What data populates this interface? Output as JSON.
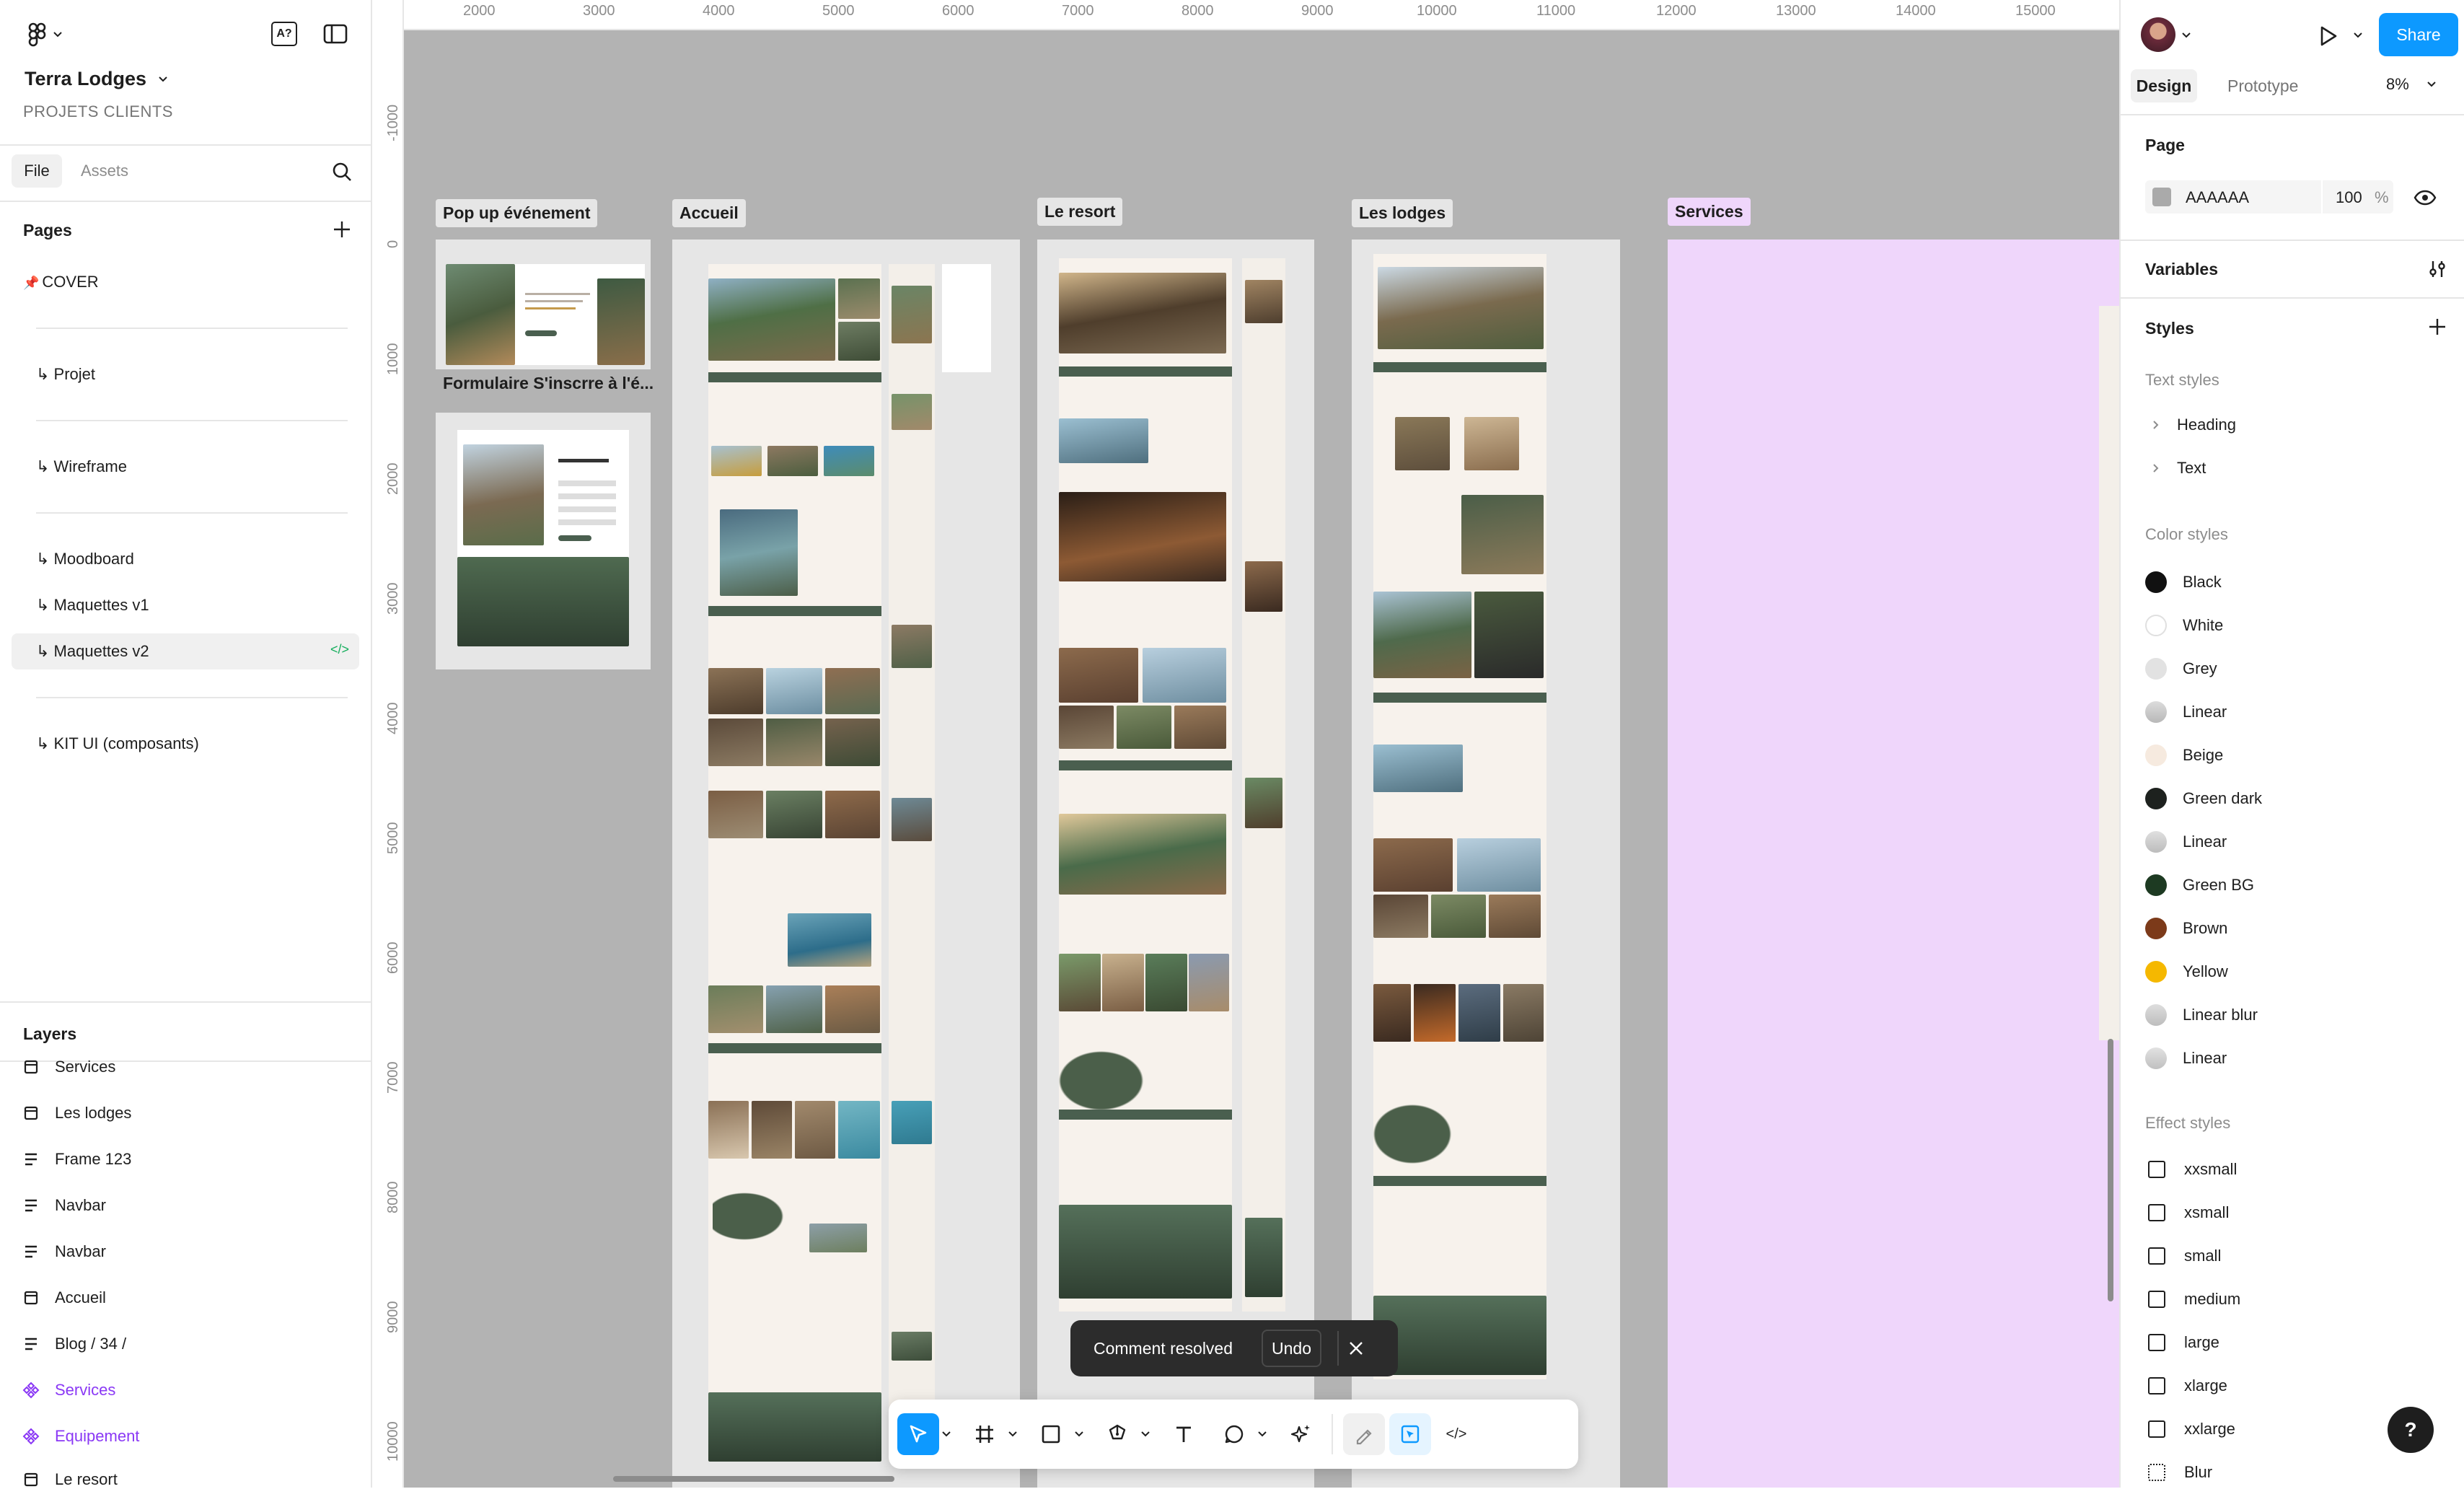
{
  "file": {
    "title": "Terra Lodges",
    "project": "PROJETS CLIENTS"
  },
  "left_tabs": {
    "file": "File",
    "assets": "Assets"
  },
  "pages": {
    "heading": "Pages",
    "items": [
      {
        "label": "COVER",
        "pin": "📌"
      },
      {
        "label": "↳ Projet"
      },
      {
        "label": "↳ Wireframe"
      },
      {
        "label": "↳ Moodboard"
      },
      {
        "label": "↳ Maquettes v1"
      },
      {
        "label": "↳ Maquettes v2",
        "selected": true
      },
      {
        "label": "↳ KIT UI (composants)"
      }
    ]
  },
  "layers": {
    "heading": "Layers",
    "items": [
      {
        "label": "Services",
        "icon": "frame-icon"
      },
      {
        "label": "Les lodges",
        "icon": "frame-icon"
      },
      {
        "label": "Frame 123",
        "icon": "auto-layout-icon"
      },
      {
        "label": "Navbar",
        "icon": "auto-layout-icon"
      },
      {
        "label": "Navbar",
        "icon": "auto-layout-icon"
      },
      {
        "label": "Accueil",
        "icon": "frame-icon"
      },
      {
        "label": "Blog / 34 /",
        "icon": "auto-layout-icon"
      },
      {
        "label": "Services",
        "icon": "component-icon"
      },
      {
        "label": "Equipement",
        "icon": "component-icon"
      },
      {
        "label": "Le resort",
        "icon": "frame-icon"
      }
    ]
  },
  "ruler_top": [
    "2000",
    "3000",
    "4000",
    "5000",
    "6000",
    "7000",
    "8000",
    "9000",
    "10000",
    "11000",
    "12000",
    "13000",
    "14000",
    "15000"
  ],
  "ruler_left": [
    "-1000",
    "0",
    "1000",
    "2000",
    "3000",
    "4000",
    "5000",
    "6000",
    "7000",
    "8000",
    "9000",
    "10000"
  ],
  "frames": {
    "popup": "Pop up événement",
    "formulaire": "Formulaire S'inscrre à l'é...",
    "accueil": "Accueil",
    "resort": "Le resort",
    "lodges": "Les lodges",
    "services": "Services"
  },
  "right_panel": {
    "tabs": {
      "design": "Design",
      "prototype": "Prototype"
    },
    "zoom": "8%",
    "share": "Share",
    "page": {
      "heading": "Page",
      "color_hex": "AAAAAA",
      "opacity": "100",
      "percent": "%",
      "swatch": "#aaaaaa"
    },
    "variables": "Variables",
    "styles": "Styles",
    "text_styles": {
      "heading": "Text styles",
      "items": [
        "Heading",
        "Text"
      ]
    },
    "color_styles": {
      "heading": "Color styles",
      "items": [
        {
          "name": "Black",
          "color": "#111111"
        },
        {
          "name": "White",
          "color": "#ffffff"
        },
        {
          "name": "Grey",
          "color": "#e2e2e2"
        },
        {
          "name": "Linear",
          "color": "#c9c9c9"
        },
        {
          "name": "Beige",
          "color": "#f6eadf"
        },
        {
          "name": "Green dark",
          "color": "#1d211e"
        },
        {
          "name": "Linear",
          "color": "#d0d0d0"
        },
        {
          "name": "Green BG",
          "color": "#1d3a22"
        },
        {
          "name": "Brown",
          "color": "#7c3a1a"
        },
        {
          "name": "Yellow",
          "color": "#f5b800"
        },
        {
          "name": "Linear blur",
          "color": "#cccccc"
        },
        {
          "name": "Linear",
          "color": "#d2d2d2"
        }
      ]
    },
    "effect_styles": {
      "heading": "Effect styles",
      "items": [
        "xxsmall",
        "xsmall",
        "small",
        "medium",
        "large",
        "xlarge",
        "xxlarge",
        "Blur"
      ]
    }
  },
  "toast": {
    "message": "Comment resolved",
    "undo": "Undo"
  },
  "help": "?",
  "colors": {
    "accent": "#0d99ff",
    "canvas": "#b3b3b3",
    "services_bg": "#efd6fb",
    "purple": "#8a38f5",
    "forest": "#4a5f4f"
  }
}
